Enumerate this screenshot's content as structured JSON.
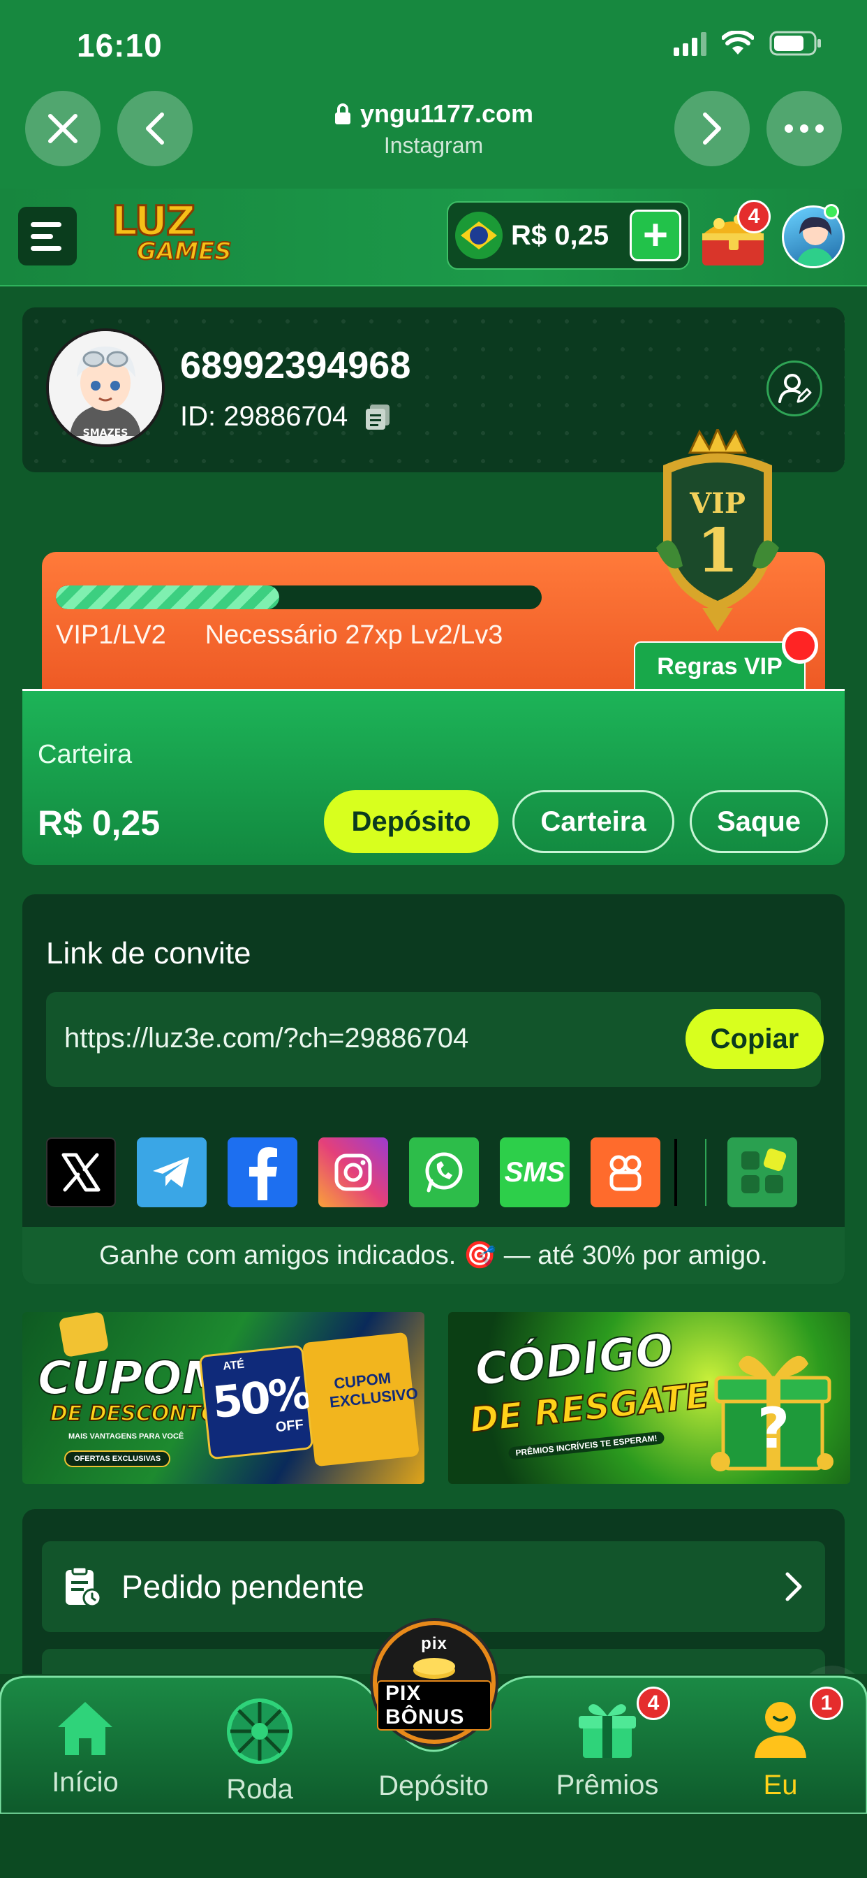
{
  "status_bar": {
    "time": "16:10"
  },
  "browser": {
    "domain": "yngu1177.com",
    "source": "Instagram"
  },
  "header": {
    "logo_line1": "LUZ",
    "logo_line2": "GAMES",
    "balance": "R$ 0,25",
    "chest_badge": "4"
  },
  "profile": {
    "phone": "68992394968",
    "id_label": "ID: 29886704",
    "avatar_text": "SMAZES"
  },
  "vip": {
    "level": "VIP1/LV2",
    "requirement": "Necessário 27xp Lv2/Lv3",
    "progress_fraction": 0.46,
    "rules_button": "Regras VIP",
    "emblem_label": "VIP",
    "emblem_number": "1"
  },
  "wallet": {
    "label": "Carteira",
    "amount": "R$ 0,25",
    "deposit_button": "Depósito",
    "wallet_button": "Carteira",
    "withdraw_button": "Saque"
  },
  "invite": {
    "title": "Link de convite",
    "url": "https://luz3e.com/?ch=29886704",
    "copy_button": "Copiar",
    "share_icons": [
      "x-icon",
      "telegram-icon",
      "facebook-icon",
      "instagram-icon",
      "whatsapp-icon",
      "sms-icon",
      "kwai-icon",
      "more-apps-icon"
    ],
    "sms_label": "SMS",
    "note": "Ganhe com amigos indicados. 🎯 — até 30% por amigo."
  },
  "banners": {
    "left": {
      "title": "CUPOM",
      "subtitle": "DE DESCONTO",
      "tagline": "MAIS VANTAGENS PARA VOCÊ",
      "pill": "OFERTAS EXCLUSIVAS",
      "ate": "ATÉ",
      "percent": "50%",
      "off": "OFF",
      "ticket": "CUPOM EXCLUSIVO"
    },
    "right": {
      "title": "CÓDIGO",
      "subtitle": "DE RESGATE",
      "tagline": "PRÊMIOS INCRÍVEIS TE ESPERAM!"
    }
  },
  "orders": {
    "pending_label": "Pedido pendente"
  },
  "bottom_nav": {
    "items": [
      {
        "label": "Início"
      },
      {
        "label": "Roda"
      },
      {
        "label": "Depósito"
      },
      {
        "label": "Prêmios",
        "badge": "4"
      },
      {
        "label": "Eu",
        "badge": "1"
      }
    ],
    "pix_top": "pix",
    "pix_bottom": "PIX BÔNUS"
  },
  "colors": {
    "primary_green": "#17883f",
    "dark_green": "#0b3a1f",
    "accent_lime": "#d8ff1e",
    "vip_orange": "#ff7a3a",
    "active_yellow": "#ffd21a",
    "badge_red": "#e52d2d"
  }
}
